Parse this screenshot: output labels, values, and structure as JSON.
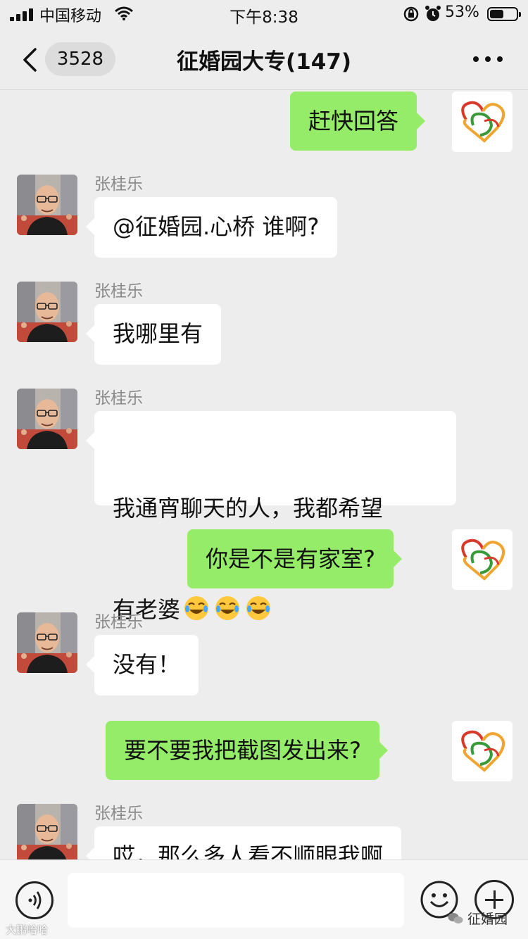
{
  "status_bar": {
    "carrier": "中国移动",
    "time": "下午8:38",
    "battery_text": "53%",
    "battery_level": 0.53,
    "icons": [
      "signal-icon",
      "wifi-icon",
      "orientation-lock-icon",
      "alarm-icon",
      "battery-icon"
    ]
  },
  "nav": {
    "unread_count": "3528",
    "title": "征婚园大专(147)",
    "icons": [
      "back-icon",
      "more-icon"
    ]
  },
  "messages": [
    {
      "side": "out",
      "text": "赶快回答"
    },
    {
      "side": "in",
      "sender": "张桂乐",
      "text": "@征婚园.心桥 谁啊?"
    },
    {
      "side": "in",
      "sender": "张桂乐",
      "text": "我哪里有"
    },
    {
      "side": "in",
      "sender": "张桂乐",
      "text_line1": "我通宵聊天的人，我都希望",
      "text_line2": "有老婆",
      "emoji": [
        "tears-of-joy-emoji",
        "tears-of-joy-emoji",
        "tears-of-joy-emoji"
      ]
    },
    {
      "side": "out",
      "text": "你是不是有家室?"
    },
    {
      "side": "in",
      "sender": "张桂乐",
      "text": "没有！"
    },
    {
      "side": "out",
      "text": "要不要我把截图发出来?"
    },
    {
      "side": "in",
      "sender": "张桂乐",
      "text": "哎，那么多人看不顺眼我啊"
    }
  ],
  "input_bar": {
    "icons": [
      "voice-icon",
      "emoji-icon",
      "plus-icon"
    ]
  },
  "watermarks": {
    "left": "大鹏哈哈",
    "right": "征婚园"
  },
  "colors": {
    "background": "#ededed",
    "bubble_out": "#95ec69",
    "bubble_in": "#ffffff",
    "sender_name": "#8a8a8a"
  }
}
